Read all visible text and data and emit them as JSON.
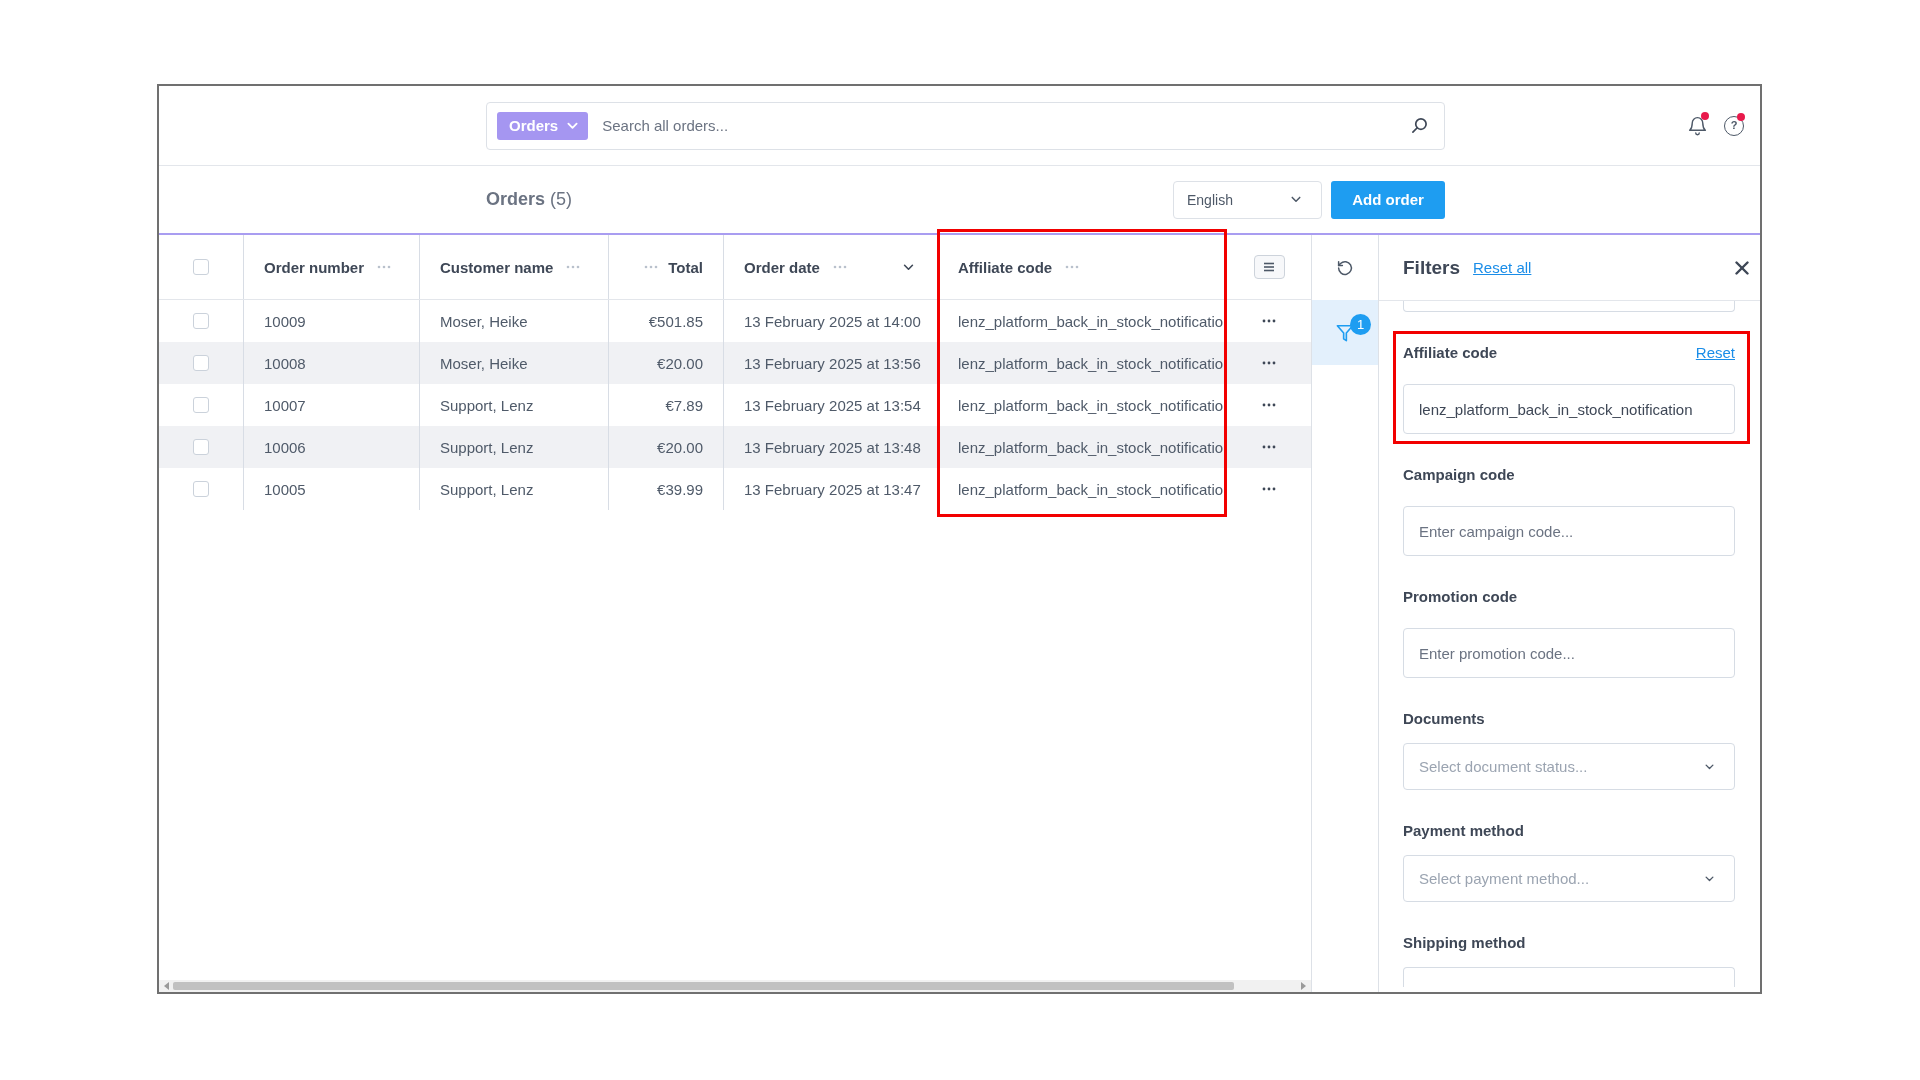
{
  "header": {
    "search": {
      "scope": "Orders",
      "placeholder": "Search all orders..."
    },
    "icons": [
      {
        "kind": "bell",
        "unread": true
      },
      {
        "kind": "help",
        "glyph": "?",
        "unread": true
      }
    ]
  },
  "toolbar": {
    "title": "**Orders** (5)",
    "language": "English",
    "add_button": "Add order"
  },
  "table": {
    "select_all": {
      "checked": false
    },
    "columns": [
      {
        "label": "Order number",
        "kind": "text",
        "sorted": false,
        "highlighted": false
      },
      {
        "label": "Customer name",
        "kind": "text",
        "sorted": false,
        "highlighted": false
      },
      {
        "label": "Total",
        "kind": "number",
        "sorted": false,
        "highlighted": false
      },
      {
        "label": "Order date",
        "kind": "text",
        "sorted": true,
        "highlighted": false
      },
      {
        "label": "Affiliate code",
        "kind": "text",
        "sorted": false,
        "highlighted": true
      }
    ],
    "rows": [
      {
        "checked": false,
        "cells": [
          "10009",
          "Moser, Heike",
          "€501.85",
          "13 February 2025 at 14:00",
          "lenz_platform_back_in_stock_notificatio"
        ]
      },
      {
        "checked": false,
        "cells": [
          "10008",
          "Moser, Heike",
          "€20.00",
          "13 February 2025 at 13:56",
          "lenz_platform_back_in_stock_notificatio"
        ]
      },
      {
        "checked": false,
        "cells": [
          "10007",
          "Support, Lenz",
          "€7.89",
          "13 February 2025 at 13:54",
          "lenz_platform_back_in_stock_notificatio"
        ]
      },
      {
        "checked": false,
        "cells": [
          "10006",
          "Support, Lenz",
          "€20.00",
          "13 February 2025 at 13:48",
          "lenz_platform_back_in_stock_notificatio"
        ]
      },
      {
        "checked": false,
        "cells": [
          "10005",
          "Support, Lenz",
          "€39.99",
          "13 February 2025 at 13:47",
          "lenz_platform_back_in_stock_notificatio"
        ]
      }
    ]
  },
  "side_tools": [
    {
      "kind": "refresh",
      "selected": false
    },
    {
      "kind": "filter",
      "selected": true,
      "badge": "1"
    }
  ],
  "filters": {
    "title": "Filters",
    "reset_all": "Reset all",
    "fields": [
      {
        "kind": "text",
        "highlighted": false
      },
      {
        "kind": "text",
        "label": "Affiliate code",
        "reset": "Reset",
        "value": "lenz_platform_back_in_stock_notification",
        "highlighted": true
      },
      {
        "kind": "text",
        "label": "Campaign code",
        "placeholder": "Enter campaign code...",
        "highlighted": false
      },
      {
        "kind": "text",
        "label": "Promotion code",
        "placeholder": "Enter promotion code...",
        "highlighted": false
      },
      {
        "kind": "select",
        "label": "Documents",
        "placeholder": "Select document status...",
        "highlighted": false
      },
      {
        "kind": "select",
        "label": "Payment method",
        "placeholder": "Select payment method...",
        "highlighted": false
      },
      {
        "kind": "select",
        "label": "Shipping method",
        "highlighted": false
      }
    ]
  }
}
